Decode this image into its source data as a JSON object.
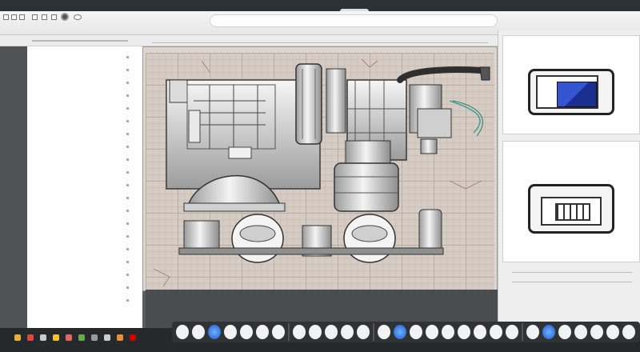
{
  "window": {
    "address_text": "",
    "tab_label": ""
  },
  "toolbar": {
    "icons": [
      "doc-icon",
      "doc-icon",
      "doc-icon",
      "doc-icon",
      "doc-icon",
      "doc-icon",
      "gear-icon",
      "record-icon"
    ]
  },
  "canvas": {
    "drawing": "mechanical-assembly-drawing",
    "grid": true
  },
  "right_panel": {
    "cards": [
      {
        "icon": "window-icon",
        "accent": "#1f3fb5"
      },
      {
        "icon": "grid-window-icon"
      }
    ]
  },
  "taskbar": {
    "items": [
      "app-icon",
      "app-icon",
      "app-icon",
      "app-icon",
      "app-icon",
      "app-icon",
      "app-icon",
      "app-icon",
      "app-icon",
      "app-icon"
    ]
  },
  "dock": {
    "items_count": 28,
    "accent": "#1d5bc5"
  }
}
